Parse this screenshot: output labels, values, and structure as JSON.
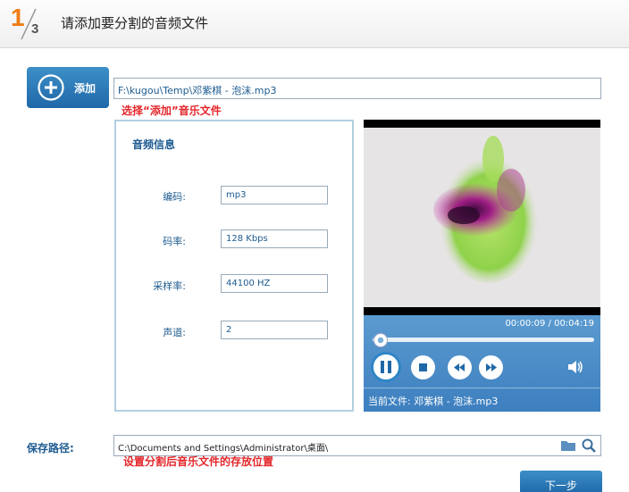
{
  "header": {
    "step_current": "1",
    "step_total": "3",
    "title": "请添加要分割的音频文件"
  },
  "add_button": {
    "label": "添加"
  },
  "file_path": "F:\\kugou\\Temp\\邓紫棋 - 泡沫.mp3",
  "hint_add": "选择“添加”音乐文件",
  "audio_info": {
    "title": "音频信息",
    "fields": [
      {
        "label": "编码:",
        "value": "mp3"
      },
      {
        "label": "码率:",
        "value": "128 Kbps"
      },
      {
        "label": "采样率:",
        "value": "44100 HZ"
      },
      {
        "label": "声道:",
        "value": "2"
      }
    ]
  },
  "player": {
    "time": "00:00:09 / 00:04:19",
    "progress": 0.035,
    "current_file": "当前文件: 邓紫棋 - 泡沫.mp3"
  },
  "save": {
    "label": "保存路径:",
    "path": "C:\\Documents and Settings\\Administrator\\桌面\\",
    "hint": "设置分割后音乐文件的存放位置"
  },
  "next_button": {
    "label": "下一步"
  },
  "colors": {
    "accent": "#f07c14",
    "primary": "#1f68a8",
    "hint": "#e4262a",
    "player_bar": "#4a8cc7"
  }
}
